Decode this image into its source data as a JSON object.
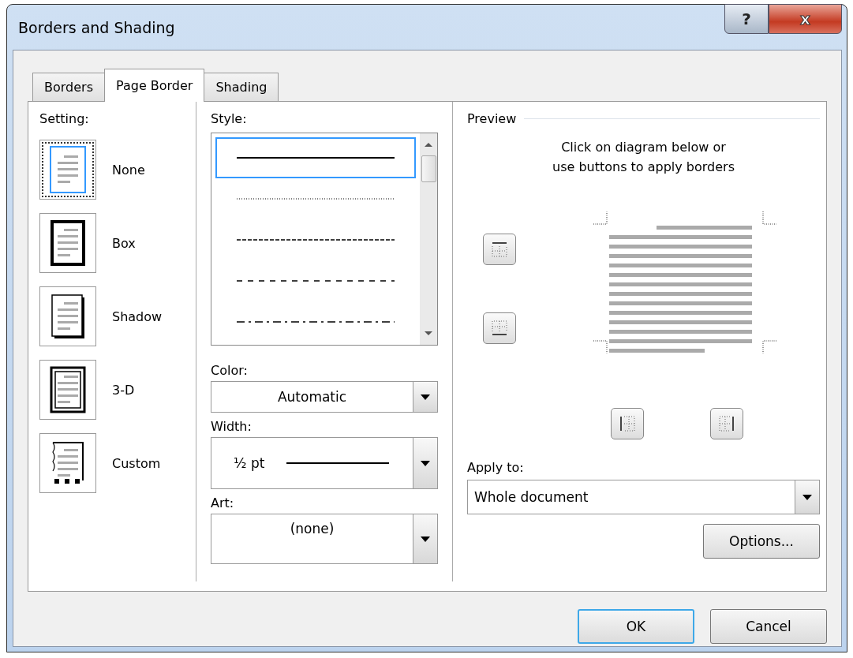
{
  "window": {
    "title": "Borders and Shading",
    "help_button": "?",
    "close_button": "x"
  },
  "tabs": [
    {
      "label": "Borders",
      "selected": false
    },
    {
      "label": "Page Border",
      "selected": true
    },
    {
      "label": "Shading",
      "selected": false
    }
  ],
  "setting": {
    "label": "Setting:",
    "items": [
      {
        "label": "None",
        "kind": "none",
        "selected": true
      },
      {
        "label": "Box",
        "kind": "box",
        "selected": false
      },
      {
        "label": "Shadow",
        "kind": "shadow",
        "selected": false
      },
      {
        "label": "3-D",
        "kind": "threed",
        "selected": false
      },
      {
        "label": "Custom",
        "kind": "custom",
        "selected": false
      }
    ]
  },
  "style": {
    "label": "Style:",
    "items": [
      {
        "kind": "solid",
        "selected": true
      },
      {
        "kind": "dotted",
        "selected": false
      },
      {
        "kind": "dashed",
        "selected": false
      },
      {
        "kind": "dash-wide",
        "selected": false
      },
      {
        "kind": "dash-dot",
        "selected": false
      }
    ]
  },
  "color": {
    "label": "Color:",
    "value": "Automatic"
  },
  "width": {
    "label": "Width:",
    "value": "½ pt"
  },
  "art": {
    "label": "Art:",
    "value": "(none)"
  },
  "preview": {
    "label": "Preview",
    "instruction": "Click on diagram below or\nuse buttons to apply borders"
  },
  "apply_to": {
    "label": "Apply to:",
    "value": "Whole document"
  },
  "options_button": "Options...",
  "buttons": [
    {
      "label": "OK",
      "default": true
    },
    {
      "label": "Cancel",
      "default": false
    }
  ]
}
